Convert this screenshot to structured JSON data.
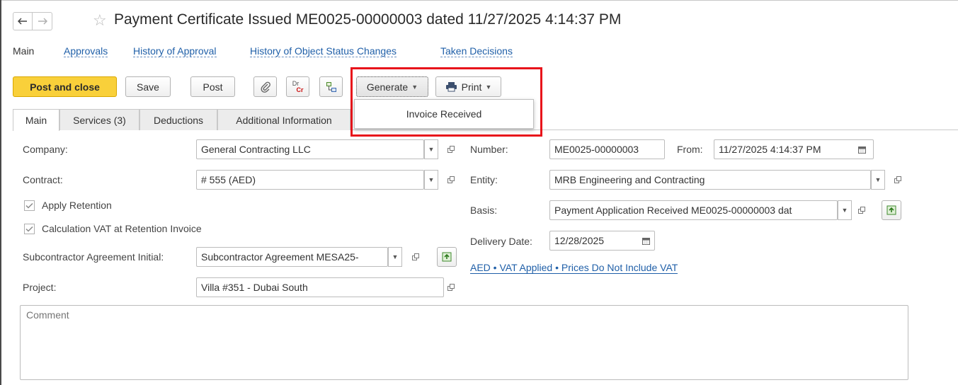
{
  "window": {
    "title": "Payment Certificate Issued ME0025-00000003 dated 11/27/2025 4:14:37 PM"
  },
  "nav": {
    "items": [
      "Main",
      "Approvals",
      "History of Approval",
      "History of Object Status Changes",
      "Taken Decisions"
    ]
  },
  "toolbar": {
    "post_and_close": "Post and close",
    "save": "Save",
    "post": "Post",
    "dtct_top": "Dr",
    "dtct_bottom": "Cr",
    "generate": "Generate",
    "print": "Print"
  },
  "generate_menu": {
    "items": [
      "Invoice Received"
    ]
  },
  "tabs": [
    "Main",
    "Services (3)",
    "Deductions",
    "Additional Information"
  ],
  "form": {
    "company_label": "Company:",
    "company_value": "General Contracting LLC",
    "contract_label": "Contract:",
    "contract_value": "# 555 (AED)",
    "apply_retention_label": "Apply Retention",
    "apply_retention_checked": true,
    "calc_vat_label": "Calculation VAT at Retention Invoice",
    "calc_vat_checked": true,
    "subcontractor_label": "Subcontractor Agreement Initial:",
    "subcontractor_value": "Subcontractor Agreement MESA25-",
    "project_label": "Project:",
    "project_value": "Villa #351 - Dubai South",
    "number_label": "Number:",
    "number_value": "ME0025-00000003",
    "from_label": "From:",
    "from_value": "11/27/2025  4:14:37 PM",
    "entity_label": "Entity:",
    "entity_value": "MRB Engineering and Contracting",
    "basis_label": "Basis:",
    "basis_value": "Payment Application Received ME0025-00000003 dat",
    "delivery_label": "Delivery Date:",
    "delivery_value": "12/28/2025",
    "vat_link": "AED • VAT Applied • Prices Do Not Include VAT",
    "comment_placeholder": "Comment"
  },
  "colors": {
    "primary_button": "#f9d03a",
    "link": "#1f5fa8",
    "highlight_box": "#e8141b"
  }
}
